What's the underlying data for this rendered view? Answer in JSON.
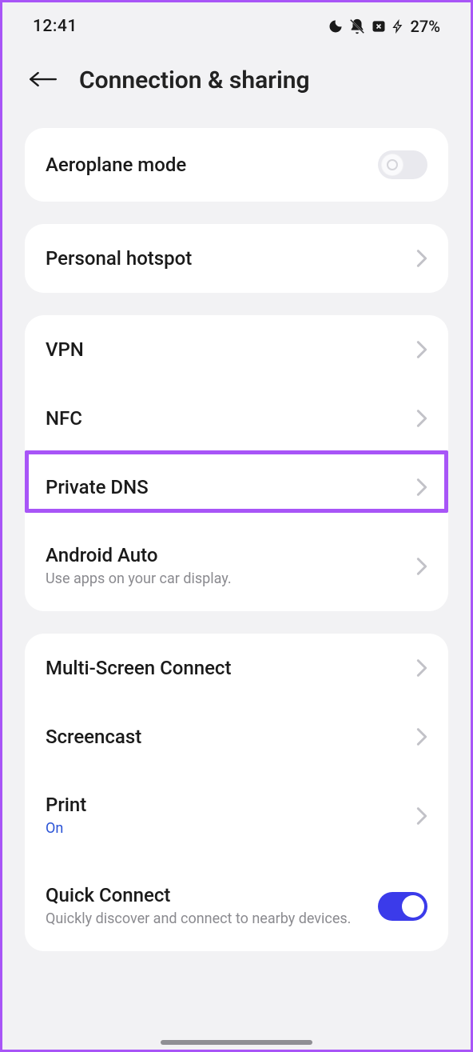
{
  "status": {
    "time": "12:41",
    "battery": "27%"
  },
  "header": {
    "title": "Connection & sharing"
  },
  "g1": {
    "aeroplane": "Aeroplane mode"
  },
  "g2": {
    "hotspot": "Personal hotspot"
  },
  "g3": {
    "vpn": "VPN",
    "nfc": "NFC",
    "dns": "Private DNS",
    "auto": "Android Auto",
    "auto_sub": "Use apps on your car display."
  },
  "g4": {
    "msc": "Multi-Screen Connect",
    "cast": "Screencast",
    "print": "Print",
    "print_sub": "On",
    "quick": "Quick Connect",
    "quick_sub": "Quickly discover and connect to nearby devices."
  }
}
